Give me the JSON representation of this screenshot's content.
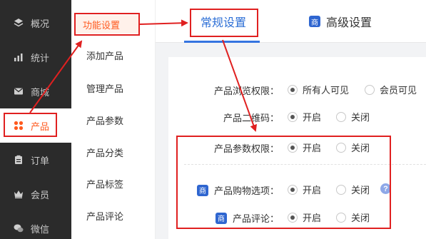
{
  "sidebar": {
    "items": [
      {
        "label": "概况",
        "icon": "layers-icon"
      },
      {
        "label": "统计",
        "icon": "chart-icon"
      },
      {
        "label": "商城",
        "icon": "mail-icon"
      },
      {
        "label": "产品",
        "icon": "grid-icon",
        "active": true
      },
      {
        "label": "订单",
        "icon": "clipboard-icon"
      },
      {
        "label": "会员",
        "icon": "crown-icon"
      },
      {
        "label": "微信",
        "icon": "wechat-icon"
      }
    ]
  },
  "subnav": {
    "items": [
      {
        "label": "功能设置",
        "active": true
      },
      {
        "label": "添加产品"
      },
      {
        "label": "管理产品"
      },
      {
        "label": "产品参数"
      },
      {
        "label": "产品分类"
      },
      {
        "label": "产品标签"
      },
      {
        "label": "产品评论"
      }
    ]
  },
  "tabs": {
    "general": "常规设置",
    "advanced": "高级设置",
    "advanced_badge": "商"
  },
  "settings": {
    "browse": {
      "label": "产品浏览权限：",
      "opt1": "所有人可见",
      "opt2": "会员可见"
    },
    "qrcode": {
      "label": "产品二维码：",
      "opt1": "开启",
      "opt2": "关闭"
    },
    "param": {
      "label": "产品参数权限：",
      "opt1": "开启",
      "opt2": "关闭"
    },
    "shopping": {
      "label": "产品购物选项：",
      "badge": "商",
      "opt1": "开启",
      "opt2": "关闭",
      "help": "?"
    },
    "review": {
      "label": "产品评论：",
      "badge": "商",
      "opt1": "开启",
      "opt2": "关闭"
    }
  },
  "colors": {
    "accent": "#ff5a1f",
    "tab_blue": "#2d6fd6",
    "annotation_red": "#e02020",
    "sidebar_bg": "#2b2b2b"
  }
}
